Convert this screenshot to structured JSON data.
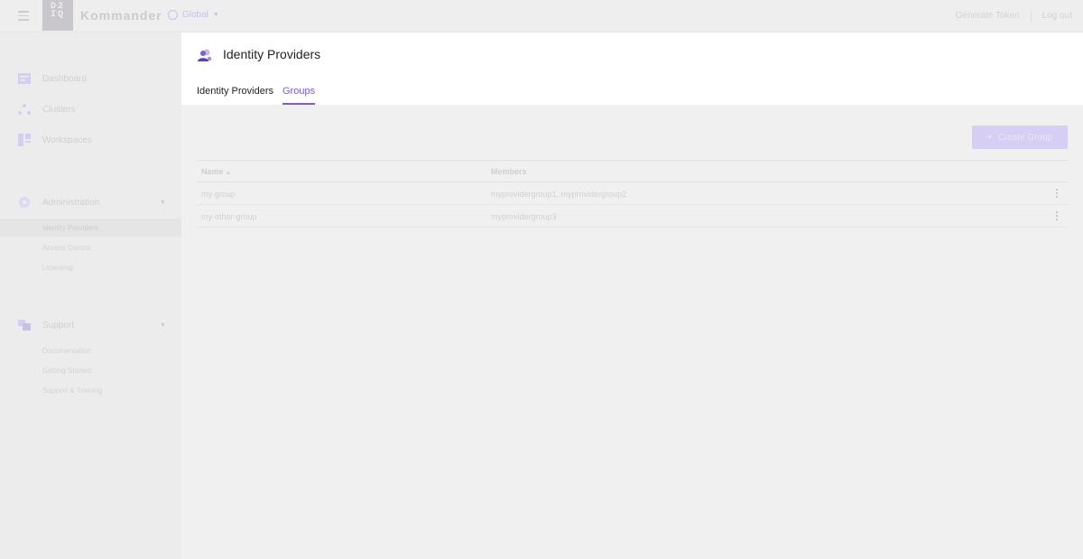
{
  "topbar": {
    "logo_lines": [
      "D2",
      "IQ"
    ],
    "brand": "Kommander",
    "scope": "Global",
    "generate_token": "Generate Token",
    "logout": "Log out"
  },
  "sidebar": {
    "items": [
      {
        "label": "Dashboard",
        "icon": "dashboard-icon"
      },
      {
        "label": "Clusters",
        "icon": "clusters-icon"
      },
      {
        "label": "Workspaces",
        "icon": "workspaces-icon"
      }
    ],
    "administration": {
      "label": "Administration",
      "icon": "gear-icon",
      "children": [
        "Identity Providers",
        "Access Control",
        "Licensing"
      ]
    },
    "support": {
      "label": "Support",
      "icon": "support-icon",
      "children": [
        "Documentation",
        "Getting Started",
        "Support & Training"
      ]
    }
  },
  "header": {
    "title": "Identity Providers",
    "tabs": [
      "Identity Providers",
      "Groups"
    ],
    "active_tab": "Groups"
  },
  "toolbar": {
    "create_label": "Create Group"
  },
  "table": {
    "columns": [
      "Name",
      "Members"
    ],
    "sort_indicator": "▲",
    "rows": [
      {
        "name": "my-group",
        "members": "myprovidergroup1, myprovidergroup2"
      },
      {
        "name": "my-other-group",
        "members": "myprovidergroup3"
      }
    ]
  },
  "colors": {
    "accent": "#7b5cd9",
    "overlay": "#f0f0f0"
  }
}
